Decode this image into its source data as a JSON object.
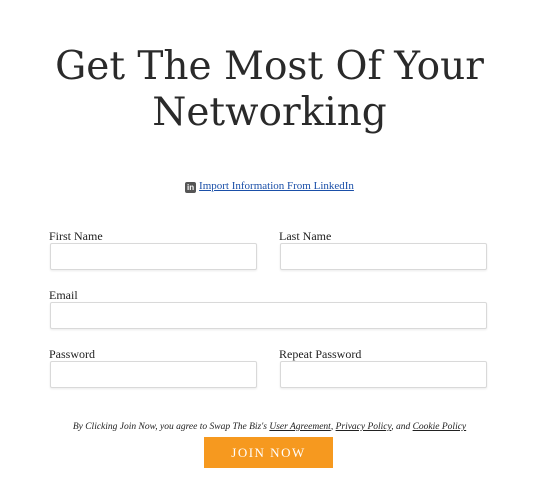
{
  "page": {
    "title_line1": "Get The Most Of Your",
    "title_line2": "Networking"
  },
  "linkedin": {
    "icon": "linkedin-icon",
    "icon_glyph": "in",
    "link_text": "Import Information From LinkedIn"
  },
  "form": {
    "first_name": {
      "label": "First Name",
      "value": "",
      "placeholder": ""
    },
    "last_name": {
      "label": "Last Name",
      "value": "",
      "placeholder": ""
    },
    "email": {
      "label": "Email",
      "value": "",
      "placeholder": ""
    },
    "password": {
      "label": "Password",
      "value": "",
      "placeholder": ""
    },
    "repeat_password": {
      "label": "Repeat Password",
      "value": "",
      "placeholder": ""
    }
  },
  "legal": {
    "prefix": "By Clicking Join Now, you agree to Swap The Biz's ",
    "user_agreement": "User Agreement",
    "sep1": ", ",
    "privacy_policy": "Privacy Policy",
    "sep2": ", and ",
    "cookie_policy": "Cookie Policy"
  },
  "actions": {
    "join_label": "JOIN NOW"
  },
  "colors": {
    "accent": "#f6991f",
    "link": "#1a4fa8",
    "text": "#222222"
  }
}
